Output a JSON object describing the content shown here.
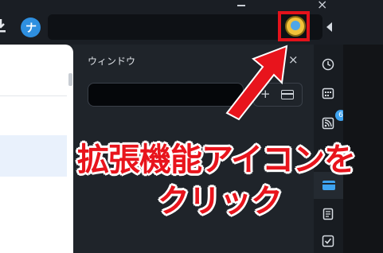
{
  "panel": {
    "title": "ウィンドウ",
    "close_glyph": "×",
    "search_placeholder": "",
    "add_glyph": "+"
  },
  "toolbar": {
    "close_glyph": "×",
    "logo_glyph": "ナ"
  },
  "rail": {
    "feed_badge": "6",
    "items": [
      "clock-icon",
      "calendar-icon",
      "rss-icon",
      "window-icon",
      "notes-icon",
      "tasks-icon"
    ]
  },
  "annotation": {
    "line1": "拡張機能アイコンを",
    "line2": "クリック",
    "color": "#e8141c"
  },
  "colors": {
    "accent": "#3ea3f0",
    "highlight": "#e4121b"
  }
}
